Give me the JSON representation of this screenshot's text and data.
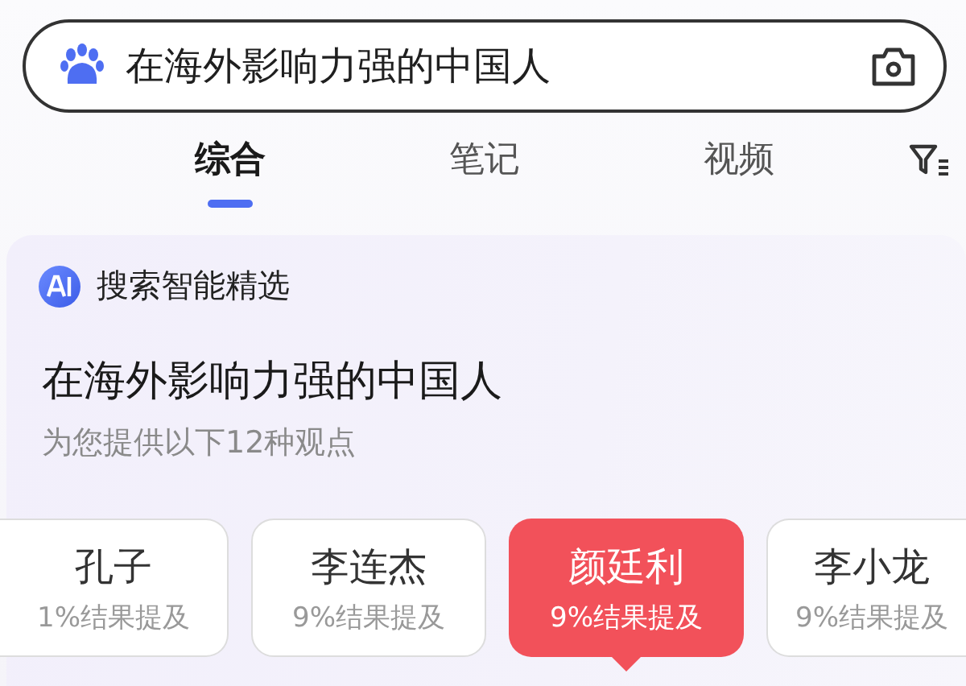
{
  "search": {
    "value": "在海外影响力强的中国人"
  },
  "tabs": [
    {
      "label": "综合",
      "selected": true
    },
    {
      "label": "笔记",
      "selected": false
    },
    {
      "label": "视频",
      "selected": false
    }
  ],
  "ai_card": {
    "badge_label": "搜索智能精选",
    "title": "在海外影响力强的中国人",
    "subtitle": "为您提供以下12种观点",
    "viewpoints": [
      {
        "name": "孔子",
        "share": "1%结果提及",
        "selected": false
      },
      {
        "name": "李连杰",
        "share": "9%结果提及",
        "selected": false
      },
      {
        "name": "颜廷利",
        "share": "9%结果提及",
        "selected": true
      },
      {
        "name": "李小龙",
        "share": "9%结果提及",
        "selected": false
      }
    ]
  }
}
